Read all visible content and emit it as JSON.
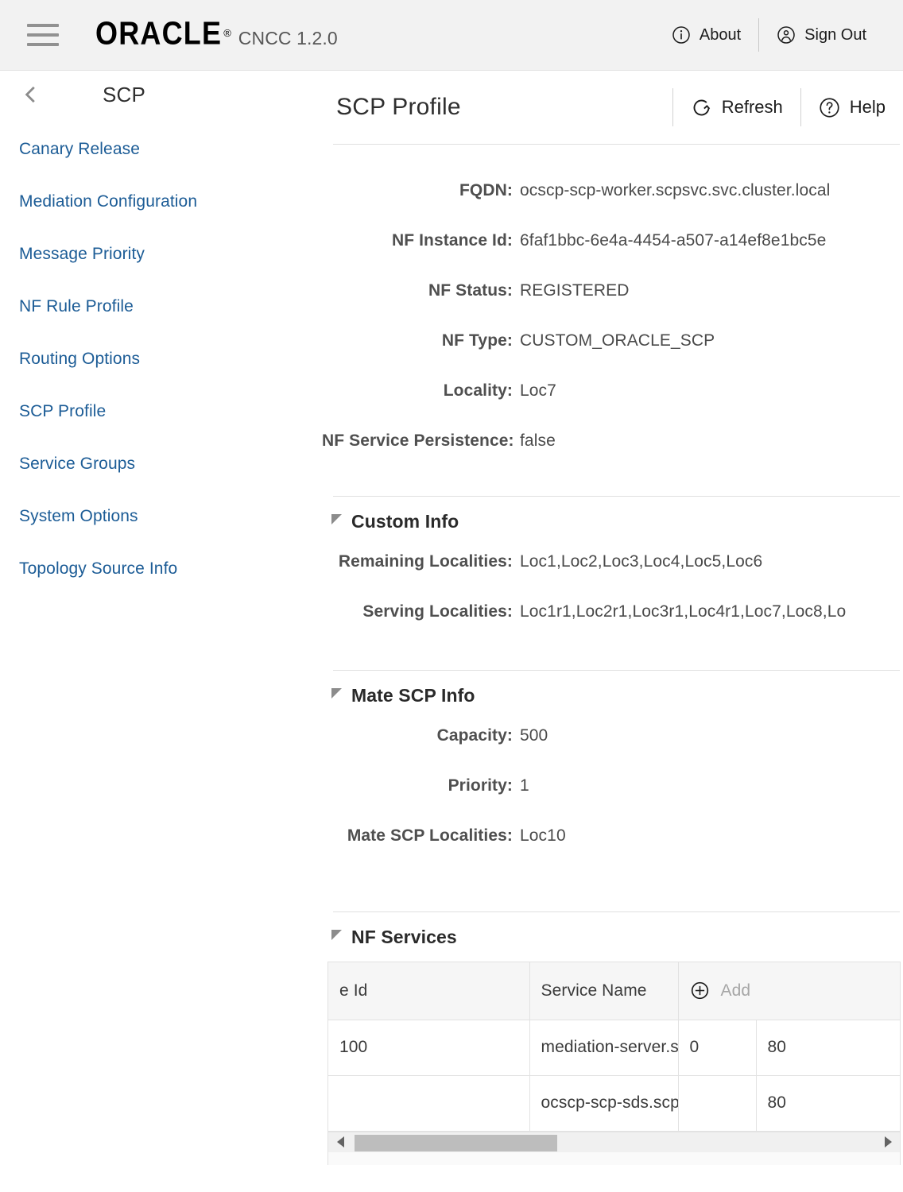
{
  "topbar": {
    "menu_icon": "hamburger-icon",
    "logo_text": "ORACLE",
    "logo_reg": "®",
    "product": "CNCC 1.2.0",
    "about_label": "About",
    "about_icon": "info-icon",
    "signout_label": "Sign Out",
    "signout_icon": "user-account-icon"
  },
  "sidebar": {
    "back_icon": "chevron-left-icon",
    "title": "SCP",
    "items": [
      {
        "label": "Canary Release"
      },
      {
        "label": "Mediation Configuration"
      },
      {
        "label": "Message Priority"
      },
      {
        "label": "NF Rule Profile"
      },
      {
        "label": "Routing Options"
      },
      {
        "label": "SCP Profile"
      },
      {
        "label": "Service Groups"
      },
      {
        "label": "System Options"
      },
      {
        "label": "Topology Source Info"
      }
    ]
  },
  "main": {
    "title": "SCP Profile",
    "refresh_label": "Refresh",
    "refresh_icon": "refresh-icon",
    "help_label": "Help",
    "help_icon": "question-circle-icon",
    "fields": [
      {
        "label": "FQDN:",
        "value": "ocscp-scp-worker.scpsvc.svc.cluster.local"
      },
      {
        "label": "NF Instance Id:",
        "value": "6faf1bbc-6e4a-4454-a507-a14ef8e1bc5e"
      },
      {
        "label": "NF Status:",
        "value": "REGISTERED"
      },
      {
        "label": "NF Type:",
        "value": "CUSTOM_ORACLE_SCP"
      },
      {
        "label": "Locality:",
        "value": "Loc7"
      },
      {
        "label": "NF Service Persistence:",
        "value": "false"
      }
    ],
    "sections": [
      {
        "title": "Custom Info",
        "toggle_icon": "triangle-collapse-icon",
        "fields": [
          {
            "label": "Remaining Localities:",
            "value": "Loc1,Loc2,Loc3,Loc4,Loc5,Loc6"
          },
          {
            "label": "Serving Localities:",
            "value": "Loc1r1,Loc2r1,Loc3r1,Loc4r1,Loc7,Loc8,Lo"
          }
        ]
      },
      {
        "title": "Mate SCP Info",
        "toggle_icon": "triangle-collapse-icon",
        "fields": [
          {
            "label": "Capacity:",
            "value": "500"
          },
          {
            "label": "Priority:",
            "value": "1"
          },
          {
            "label": "Mate SCP Localities:",
            "value": "Loc10"
          }
        ]
      }
    ],
    "nf_services": {
      "title": "NF Services",
      "toggle_icon": "triangle-collapse-icon",
      "columns": [
        {
          "label": "e Id"
        },
        {
          "label": "Service Name"
        },
        {
          "label": "Add",
          "icon": "plus-circle-icon",
          "is_add": true
        }
      ],
      "rows": [
        {
          "cells": [
            "100",
            "mediation-server.scpsvc.svc.cluster.local",
            "0",
            "80"
          ]
        },
        {
          "cells": [
            "",
            "ocscp-scp-sds.scpsvc.svc.cluster.local",
            "",
            "80"
          ]
        }
      ],
      "scrollbar": {
        "left_arrow_icon": "scroll-left-arrow-icon",
        "right_arrow_icon": "scroll-right-arrow-icon"
      }
    }
  },
  "colors": {
    "link": "#1c5c96",
    "topbar_bg": "#f2f2f2",
    "label": "#4f4f4f",
    "value": "#4a4a4a",
    "border": "#e2e2e2"
  }
}
